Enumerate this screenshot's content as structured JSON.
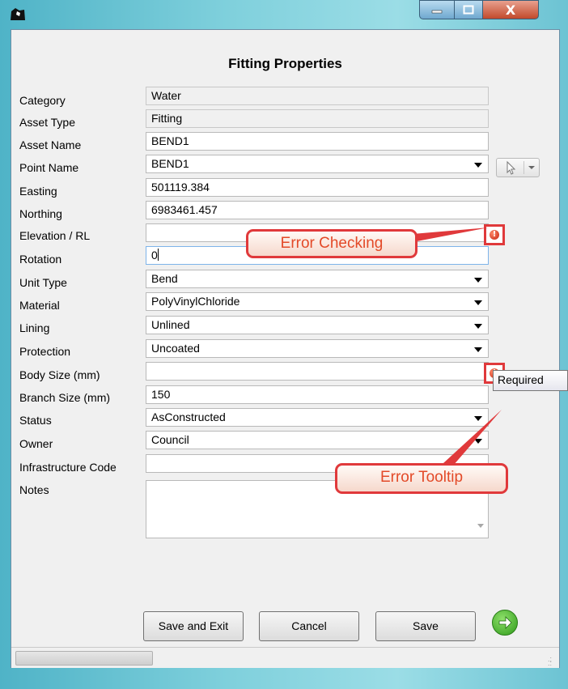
{
  "window": {
    "icon": "app-logo-icon",
    "controls": {
      "minimize_icon": "minimize-icon",
      "maximize_icon": "maximize-icon",
      "close_label": "X"
    }
  },
  "form": {
    "title": "Fitting Properties",
    "fields": {
      "category": {
        "label": "Category",
        "value": "Water"
      },
      "asset_type": {
        "label": "Asset Type",
        "value": "Fitting"
      },
      "asset_name": {
        "label": "Asset Name",
        "value": "BEND1"
      },
      "point_name": {
        "label": "Point Name",
        "value": "BEND1"
      },
      "easting": {
        "label": "Easting",
        "value": "501119.384"
      },
      "northing": {
        "label": "Northing",
        "value": "6983461.457"
      },
      "elevation": {
        "label": "Elevation / RL",
        "value": ""
      },
      "rotation": {
        "label": "Rotation",
        "value": "0"
      },
      "unit_type": {
        "label": "Unit Type",
        "value": "Bend"
      },
      "material": {
        "label": "Material",
        "value": "PolyVinylChloride"
      },
      "lining": {
        "label": "Lining",
        "value": "Unlined"
      },
      "protection": {
        "label": "Protection",
        "value": "Uncoated"
      },
      "body_size": {
        "label": "Body Size (mm)",
        "value": ""
      },
      "branch_size": {
        "label": "Branch Size (mm)",
        "value": "150"
      },
      "status": {
        "label": "Status",
        "value": "AsConstructed"
      },
      "owner": {
        "label": "Owner",
        "value": "Council"
      },
      "infrastructure_code": {
        "label": "Infrastructure Code",
        "value": ""
      },
      "notes": {
        "label": "Notes",
        "value": ""
      }
    }
  },
  "annotations": {
    "error_checking": "Error Checking",
    "error_tooltip": "Error Tooltip",
    "tooltip_text": "Required",
    "error_icon": "error-exclamation-icon",
    "accent_color": "#e0393b"
  },
  "buttons": {
    "save_and_exit": "Save and Exit",
    "cancel": "Cancel",
    "save": "Save",
    "next_icon": "next-arrow-icon"
  }
}
